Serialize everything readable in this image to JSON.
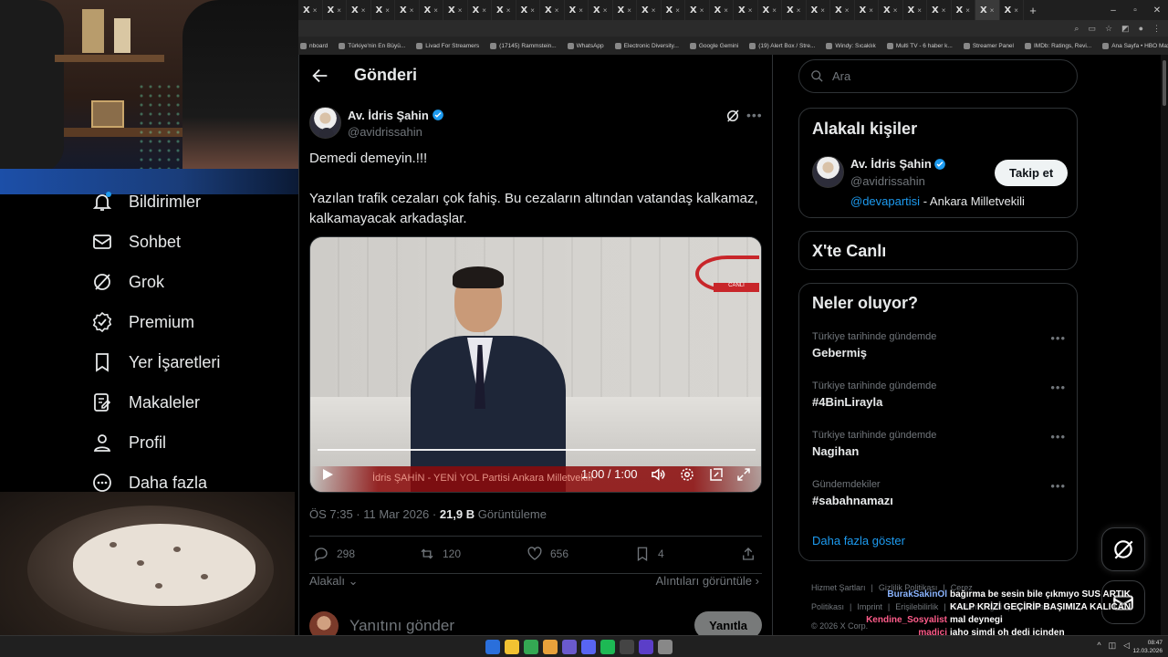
{
  "browser": {
    "tab_count": 30,
    "tab_glyph": "X",
    "bookmarks": [
      "nboard",
      "Türkiye'nin En Büyü...",
      "Livad For Streamers",
      "(17145) Rammstein...",
      "WhatsApp",
      "Electronic Diversity...",
      "Google Gemini",
      "(19) Alert Box / Stre...",
      "Windy: Sıcaklık",
      "Multi TV - 6 haber k...",
      "Streamer Panel",
      "IMDb: Ratings, Revi...",
      "Ana Sayfa • HBO Max"
    ],
    "bookmarks_overflow": "»",
    "all_bookmarks": "Tüm Yer İşaretleri"
  },
  "nav": {
    "items": [
      {
        "label": "Bildirimler",
        "icon": "bell-icon"
      },
      {
        "label": "Sohbet",
        "icon": "mail-icon"
      },
      {
        "label": "Grok",
        "icon": "grok-icon"
      },
      {
        "label": "Premium",
        "icon": "premium-icon"
      },
      {
        "label": "Yer İşaretleri",
        "icon": "bookmark-icon"
      },
      {
        "label": "Makaleler",
        "icon": "article-icon"
      },
      {
        "label": "Profil",
        "icon": "person-icon"
      },
      {
        "label": "Daha fazla",
        "icon": "more-circle-icon"
      }
    ]
  },
  "header": {
    "title": "Gönderi"
  },
  "post": {
    "author_name": "Av. İdris Şahin",
    "author_handle": "@avidrissahin",
    "text_line1": "Demedi demeyin.!!!",
    "text_line2": "Yazılan trafik cezaları çok fahiş. Bu cezaların altından vatandaş kalkamaz, kalkamayacak arkadaşlar.",
    "video": {
      "time": "1:00 / 1:00",
      "lower_third": "İdris ŞAHİN - YENİ YOL Partisi Ankara Milletvekili",
      "channel_logo": "TBMM",
      "channel_live": "CANLI"
    },
    "time": "ÖS 7:35 · 11 Mar 2026 · ",
    "views": "21,9 B",
    "views_label": " Görüntüleme",
    "replies": "298",
    "reposts": "120",
    "likes": "656",
    "bookmarks": "4",
    "sort_label": "Alakalı",
    "quotes_label": "Alıntıları görüntüle",
    "reply_placeholder": "Yanıtını gönder",
    "reply_button": "Yanıtla"
  },
  "search": {
    "placeholder": "Ara"
  },
  "related": {
    "title": "Alakalı kişiler",
    "name": "Av. İdris Şahin",
    "handle": "@avidrissahin",
    "follow": "Takip et",
    "bio_mention": "@devapartisi",
    "bio_rest": " - Ankara Milletvekili"
  },
  "live": {
    "title": "X'te Canlı"
  },
  "trends": {
    "title": "Neler oluyor?",
    "items": [
      {
        "context": "Türkiye tarihinde gündemde",
        "name": "Gebermiş"
      },
      {
        "context": "Türkiye tarihinde gündemde",
        "name": "#4BinLirayla"
      },
      {
        "context": "Türkiye tarihinde gündemde",
        "name": "Nagihan"
      },
      {
        "context": "Gündemdekiler",
        "name": "#sabahnamazı"
      }
    ],
    "show_more": "Daha fazla göster"
  },
  "footer": {
    "links": [
      "Hizmet Şartları",
      "|",
      "Gizlilik Politikası",
      "|",
      "Çerez Politikası",
      "|",
      "Imprint",
      "|",
      "Erişilebilirlik",
      "|",
      "Reklam bilgisi",
      "|",
      "Daha fazla ..."
    ],
    "copyright": "© 2026 X Corp."
  },
  "chat": [
    {
      "user": "BurakSakinOl",
      "text": "bağırma be sesin bile çıkmıyo SUS ARTIK",
      "color": "#8ab4ff"
    },
    {
      "user": "",
      "text": "KALP KRİZİ GEÇİRİP BAŞIMIZA KALICAN",
      "color": "#8ab4ff"
    },
    {
      "user": "Kendine_Sosyalist",
      "text": "mal deynegi",
      "color": "#ff5c8a"
    },
    {
      "user": "madici",
      "text": "jaho simdi oh dedi icinden",
      "color": "#ff5c8a"
    }
  ],
  "taskbar": {
    "time": "08:47",
    "date": "12.03.2026"
  },
  "colors": {
    "accent": "#1d9bf0",
    "bg": "#000000",
    "border": "#2f3336",
    "muted": "#71767b"
  }
}
